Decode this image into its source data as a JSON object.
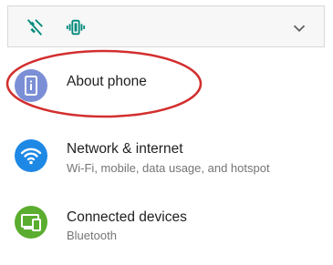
{
  "quick_settings": {
    "icons": [
      "do-not-disturb-off-icon",
      "vibrate-icon",
      "chevron-down-icon"
    ],
    "accent_color": "#00897b"
  },
  "settings": [
    {
      "title": "About phone",
      "subtitle": "",
      "icon": "phone-info-icon",
      "icon_color": "#7b8fd6"
    },
    {
      "title": "Network & internet",
      "subtitle": "Wi-Fi, mobile, data usage, and hotspot",
      "icon": "wifi-icon",
      "icon_color": "#1e88e5"
    },
    {
      "title": "Connected devices",
      "subtitle": "Bluetooth",
      "icon": "devices-icon",
      "icon_color": "#5aad2e"
    }
  ],
  "annotation": {
    "color": "#d32f2f"
  }
}
